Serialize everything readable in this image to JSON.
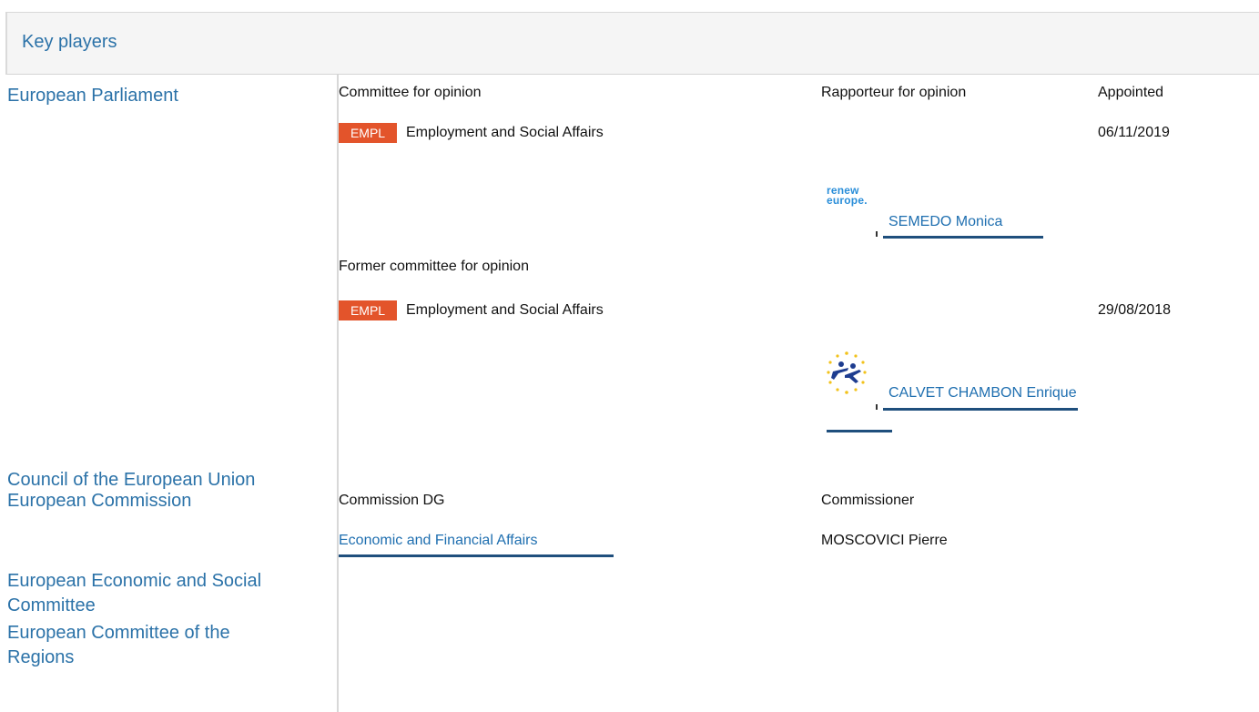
{
  "header": {
    "title": "Key players"
  },
  "players": [
    {
      "label": "European Parliament"
    },
    {
      "label": "Council of the European Union"
    },
    {
      "label": "European Commission"
    },
    {
      "label": "European Economic and Social Committee"
    },
    {
      "label": "European Committee of the Regions"
    }
  ],
  "ep": {
    "committee_for_opinion": "Committee for opinion",
    "rapporteur_for_opinion": "Rapporteur for opinion",
    "appointed": "Appointed",
    "current": {
      "badge": "EMPL",
      "name": "Employment and Social Affairs",
      "date": "06/11/2019",
      "rapporteur": "SEMEDO Monica",
      "group_logo_text": "renew europe."
    },
    "former_committee_for_opinion": "Former committee for opinion",
    "former": {
      "badge": "EMPL",
      "name": "Employment and Social Affairs",
      "date": "29/08/2018",
      "rapporteur": "CALVET CHAMBON Enrique"
    }
  },
  "commission": {
    "dg_label": "Commission DG",
    "commissioner_label": "Commissioner",
    "dg": "Economic and Financial Affairs",
    "commissioner": "MOSCOVICI Pierre"
  },
  "colors": {
    "accent": "#2b72a8",
    "badge": "#e3542b",
    "underline": "#1f4f7d"
  }
}
